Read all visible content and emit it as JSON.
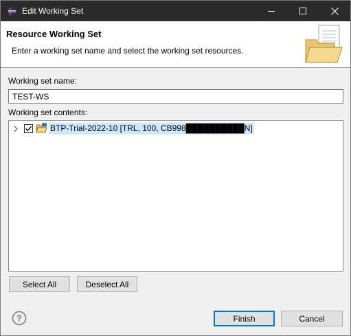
{
  "window": {
    "title": "Edit Working Set",
    "controls": [
      "minimize-icon",
      "maximize-icon",
      "close-icon"
    ]
  },
  "banner": {
    "heading": "Resource Working Set",
    "description": "Enter a working set name and select the working set resources.",
    "icon": "folder-document-icon"
  },
  "form": {
    "name_label": "Working set name:",
    "name_value": "TEST-WS",
    "contents_label": "Working set contents:"
  },
  "tree": {
    "items": [
      {
        "label": "BTP-Trial-2022-10 [TRL, 100, CB998██████████N]",
        "checked": true,
        "expanded": false,
        "icon": "project-folder-icon"
      }
    ]
  },
  "buttons": {
    "select_all": "Select All",
    "deselect_all": "Deselect All",
    "finish": "Finish",
    "cancel": "Cancel"
  },
  "colors": {
    "titlebar": "#2b2b2b",
    "selection": "#cce8ff",
    "default_button_border": "#0078d7"
  }
}
